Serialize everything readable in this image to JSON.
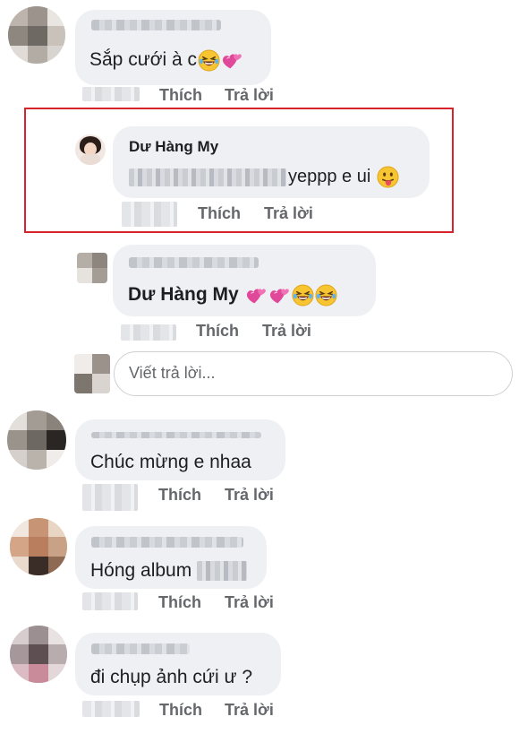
{
  "actions": {
    "like": "Thích",
    "reply": "Trả lời"
  },
  "comments": [
    {
      "text": "Sắp cưới à c"
    },
    {
      "author": "Dư Hàng My",
      "text": "yeppp e ui"
    },
    {
      "text": "Dư Hàng My"
    },
    {
      "text": "Chúc mừng e nhaa"
    },
    {
      "text": "Hóng album"
    },
    {
      "text": "đi chụp ảnh cứi ư ?"
    }
  ],
  "reply_box": {
    "placeholder": "Viết trả lời..."
  },
  "emojis": [
    "rolling-laughing",
    "two-hearts",
    "tongue-out"
  ],
  "colors": {
    "highlight": "#d9232b",
    "bubble": "#eef0f3",
    "meta": "#65676b"
  }
}
